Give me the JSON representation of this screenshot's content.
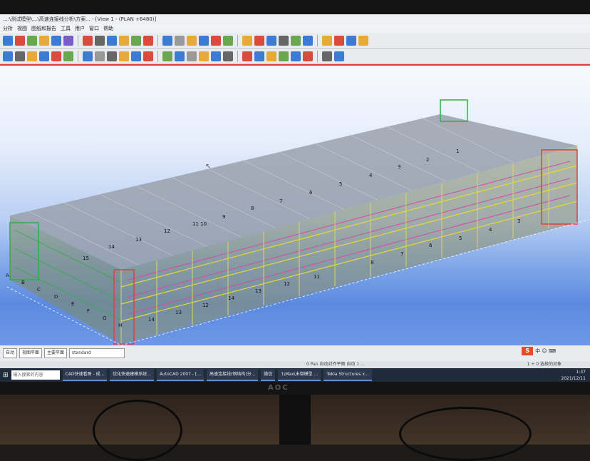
{
  "window": {
    "title": "...:\\测试模型\\...\\高速连接线分析\\方案... - [View 1 - (PLAN +6480)]",
    "menu": [
      "分析",
      "视图",
      "图纸和报告",
      "工具",
      "用户",
      "窗口",
      "帮助"
    ]
  },
  "toolbar": {
    "row1_colors": [
      "#3b7bd6",
      "#d94b3b",
      "#6aa84f",
      "#e8a83a",
      "#3b7bd6",
      "#7a5cc8",
      "#d94b3b",
      "#666666",
      "#3b7bd6",
      "#e8a83a",
      "#6aa84f",
      "#d94b3b",
      "#3b7bd6",
      "#999999",
      "#e8a83a",
      "#3b7bd6",
      "#d94b3b",
      "#6aa84f",
      "#e8a83a",
      "#d94b3b",
      "#3b7bd6",
      "#666666",
      "#6aa84f",
      "#3b7bd6",
      "#e8a83a",
      "#d94b3b",
      "#3b7bd6",
      "#e8a83a"
    ],
    "row2_colors": [
      "#3b7bd6",
      "#666666",
      "#e8a83a",
      "#3b7bd6",
      "#d94b3b",
      "#6aa84f",
      "#3b7bd6",
      "#999999",
      "#666666",
      "#e8a83a",
      "#3b7bd6",
      "#d94b3b",
      "#6aa84f",
      "#3b7bd6",
      "#999999",
      "#e8a83a",
      "#3b7bd6",
      "#666666",
      "#d94b3b",
      "#3b7bd6",
      "#e8a83a",
      "#6aa84f",
      "#3b7bd6",
      "#d94b3b",
      "#666666",
      "#3b7bd6"
    ]
  },
  "viewport": {
    "grid_labels_front": [
      "15",
      "14",
      "13",
      "12",
      "11",
      "10",
      "9",
      "8",
      "7",
      "6",
      "5",
      "4",
      "3",
      "2",
      "1"
    ],
    "grid_labels_top": [
      "14",
      "13",
      "12",
      "11 10",
      "9",
      "8",
      "7",
      "6",
      "5",
      "4",
      "3",
      "2",
      "1"
    ],
    "grid_labels_left": [
      "A",
      "B",
      "C",
      "D",
      "E",
      "F",
      "G",
      "H"
    ]
  },
  "bottombar": {
    "select1": "自动",
    "select2": "视图平面",
    "select3": "主要平面",
    "select4": "standard"
  },
  "statusbar": {
    "text": "0   Pan    自动对齐平面   自动 1 ...",
    "right": "1 + 0 选择的对象"
  },
  "taskbar": {
    "search": "输入搜索的内容",
    "items": [
      "CAD快速看图 - 成...",
      "优化快速建模系统...",
      "AutoCAD 2007 - [...",
      "高速连接线(钢结构)分...",
      "微信",
      "1\\Max\\未增模型 ...",
      "Tekla Structures x..."
    ],
    "time": "1:37",
    "date": "2021/12/11"
  },
  "monitor": {
    "brand": "AOC"
  }
}
